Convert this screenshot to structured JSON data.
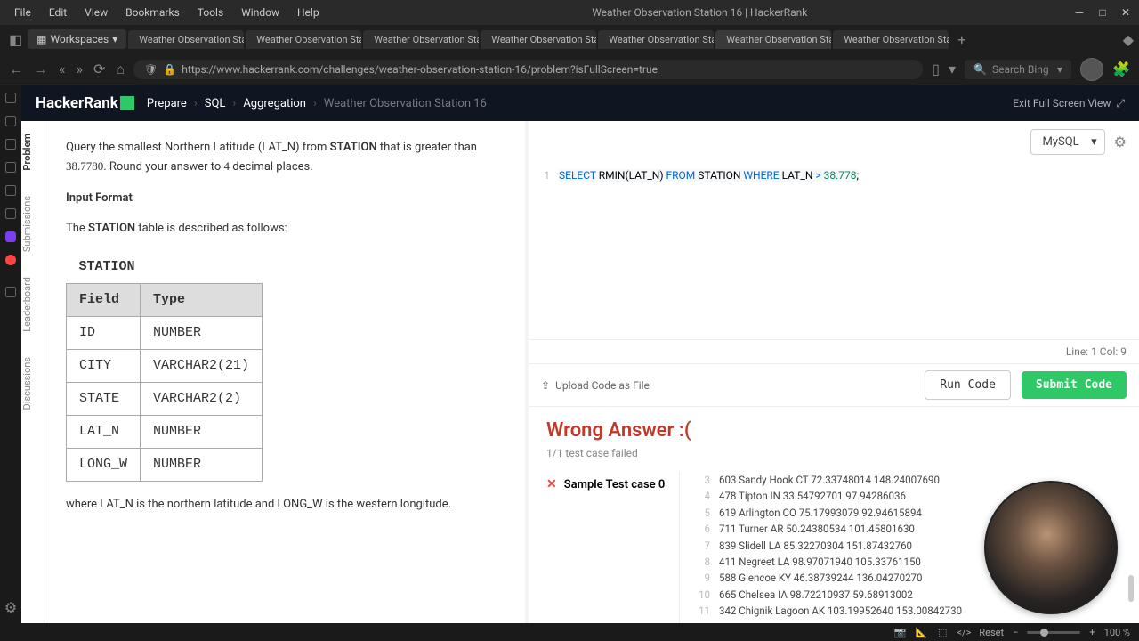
{
  "os": {
    "menu": [
      "File",
      "Edit",
      "View",
      "Bookmarks",
      "Tools",
      "Window",
      "Help"
    ],
    "title": "Weather Observation Station 16 | HackerRank",
    "workspaces": "Workspaces"
  },
  "tabs": [
    "Weather Observation Stati",
    "Weather Observation Stati",
    "Weather Observation Stati",
    "Weather Observation Stati",
    "Weather Observation Stati",
    "Weather Observation Stati",
    "Weather Observation Stati"
  ],
  "url": "https://www.hackerrank.com/challenges/weather-observation-station-16/problem?isFullScreen=true",
  "search_placeholder": "Search Bing",
  "header": {
    "logo": "HackerRank",
    "crumbs": [
      "Prepare",
      "SQL",
      "Aggregation",
      "Weather Observation Station 16"
    ],
    "exit": "Exit Full Screen View"
  },
  "sidetabs": [
    "Problem",
    "Submissions",
    "Leaderboard",
    "Discussions"
  ],
  "problem": {
    "query_prefix": "Query the smallest Northern Latitude (LAT_N) from ",
    "station": "STATION",
    "query_mid": " that is greater than ",
    "value": "38.7780",
    "query_suffix": ". Round your answer to ",
    "decimals": "4",
    "decimals_suffix": " decimal places.",
    "input_format": "Input Format",
    "described": "The STATION table is described as follows:",
    "table_title": "STATION",
    "schema": {
      "header": [
        "Field",
        "Type"
      ],
      "rows": [
        [
          "ID",
          "NUMBER"
        ],
        [
          "CITY",
          "VARCHAR2(21)"
        ],
        [
          "STATE",
          "VARCHAR2(2)"
        ],
        [
          "LAT_N",
          "NUMBER"
        ],
        [
          "LONG_W",
          "NUMBER"
        ]
      ]
    },
    "note": "where LAT_N is the northern latitude and LONG_W is the western longitude."
  },
  "editor": {
    "lang": "MySQL",
    "line_no": "1",
    "code_select": "SELECT",
    "code_mid": " RMIN(LAT_N) ",
    "code_from": "FROM",
    "code_station": " STATION ",
    "code_where": "WHERE",
    "code_col": " LAT_N ",
    "code_gt": ">",
    "code_val": " 38.778",
    "code_end": ";",
    "linecol": "Line: 1 Col: 9",
    "upload": "Upload Code as File",
    "run": "Run Code",
    "submit": "Submit Code"
  },
  "result": {
    "title": "Wrong Answer :(",
    "count": "1/1 test case failed",
    "case_name": "Sample Test case 0",
    "output": [
      {
        "n": "3",
        "t": "603 Sandy Hook CT 72.33748014 148.24007690"
      },
      {
        "n": "4",
        "t": "478 Tipton IN 33.54792701 97.94286036"
      },
      {
        "n": "5",
        "t": "619 Arlington CO 75.17993079 92.94615894"
      },
      {
        "n": "6",
        "t": "711 Turner AR 50.24380534 101.45801630"
      },
      {
        "n": "7",
        "t": "839 Slidell LA 85.32270304 151.87432760"
      },
      {
        "n": "8",
        "t": "411 Negreet LA 98.97071940 105.33761150"
      },
      {
        "n": "9",
        "t": "588 Glencoe KY 46.38739244 136.04270270"
      },
      {
        "n": "10",
        "t": "665 Chelsea IA 98.72210937 59.68913002"
      },
      {
        "n": "11",
        "t": "342 Chignik Lagoon AK 103.19952640 153.00842730"
      }
    ]
  },
  "footer": {
    "reset": "Reset",
    "zoom": "100 %"
  }
}
